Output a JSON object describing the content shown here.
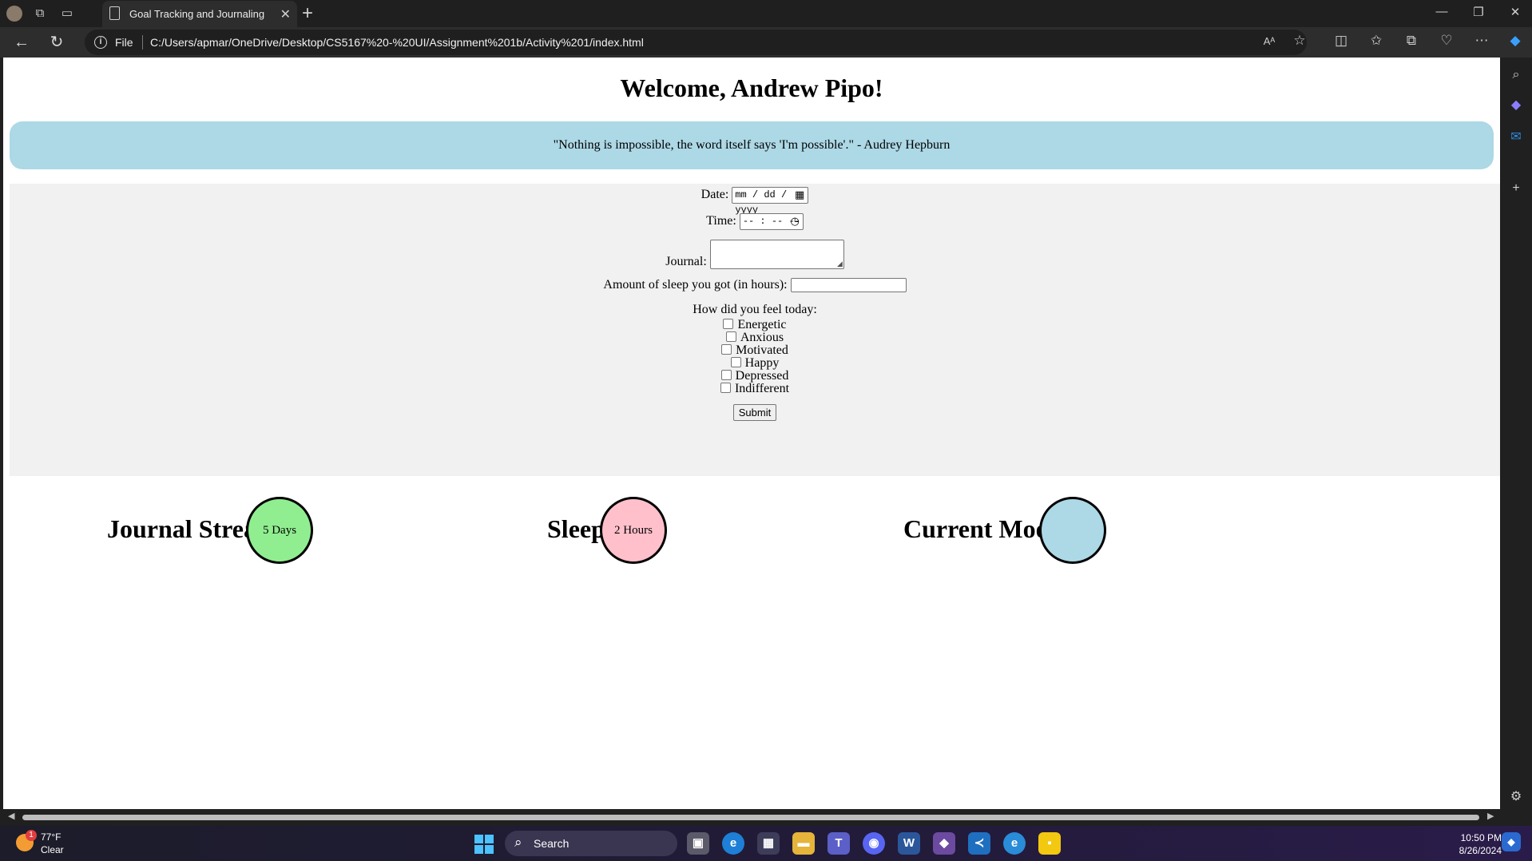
{
  "browser": {
    "tab_title": "Goal Tracking and Journaling",
    "address_scheme": "File",
    "url": "C:/Users/apmar/OneDrive/Desktop/CS5167%20-%20UI/Assignment%201b/Activity%201/index.html"
  },
  "page": {
    "welcome": "Welcome, Andrew Pipo!",
    "quote": "\"Nothing is impossible, the word itself says 'I'm possible'.\" - Audrey Hepburn",
    "form": {
      "date_label": "Date:",
      "date_placeholder": "mm / dd / yyyy",
      "time_label": "Time:",
      "time_placeholder": "-- : -- --",
      "journal_label": "Journal:",
      "sleep_label": "Amount of sleep you got (in hours):",
      "feel_label": "How did you feel today:",
      "moods": [
        "Energetic",
        "Anxious",
        "Motivated",
        "Happy",
        "Depressed",
        "Indifferent"
      ],
      "submit_label": "Submit"
    },
    "stats": {
      "streak_label": "Journal Streak",
      "streak_value": "5 Days",
      "sleep_label": "Sleep",
      "sleep_value": "2 Hours",
      "mood_label": "Current Mood",
      "mood_value": ""
    }
  },
  "colors": {
    "quote_bg": "#add8e6",
    "streak_circle": "#90ee90",
    "sleep_circle": "#ffc0cb",
    "mood_circle": "#add8e6"
  },
  "taskbar": {
    "weather_badge": "1",
    "weather_temp": "77°F",
    "weather_condition": "Clear",
    "search_label": "Search",
    "time": "10:50 PM",
    "date": "8/26/2024"
  }
}
